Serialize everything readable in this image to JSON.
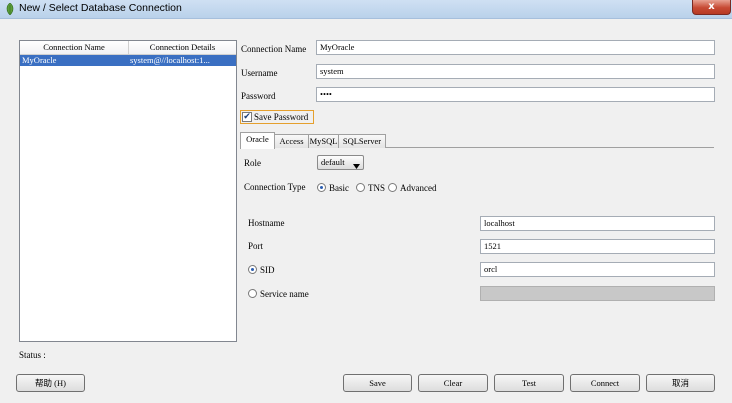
{
  "window": {
    "title": "New / Select Database Connection",
    "close_symbol": "x"
  },
  "connections_table": {
    "headers": [
      "Connection Name",
      "Connection Details"
    ],
    "rows": [
      {
        "name": "MyOracle",
        "details": "system@//localhost:1..."
      }
    ]
  },
  "form": {
    "connection_name_label": "Connection Name",
    "connection_name_value": "MyOracle",
    "username_label": "Username",
    "username_value": "system",
    "password_label": "Password",
    "password_value": "••••",
    "save_password_label": "Save Password",
    "save_password_checked": true
  },
  "tabs": [
    "Oracle",
    "Access",
    "MySQL",
    "SQLServer"
  ],
  "oracle": {
    "role_label": "Role",
    "role_value": "default",
    "connection_type_label": "Connection Type",
    "connection_types": [
      "Basic",
      "TNS",
      "Advanced"
    ],
    "selected_connection_type": "Basic",
    "hostname_label": "Hostname",
    "hostname_value": "localhost",
    "port_label": "Port",
    "port_value": "1521",
    "sid_label": "SID",
    "sid_value": "orcl",
    "service_name_label": "Service name",
    "service_name_value": ""
  },
  "status_label": "Status :",
  "buttons": {
    "help": "帮助 (H)",
    "save": "Save",
    "clear": "Clear",
    "test": "Test",
    "connect": "Connect",
    "cancel": "取消"
  },
  "colors": {
    "selection": "#3a6fc2",
    "title_bar": "#b9d1ea",
    "close_button": "#c74a34",
    "save_password_focus": "#e5a02e"
  },
  "icons": {
    "app": "database-leaf-icon",
    "close": "close-icon",
    "dropdown": "chevron-down-icon",
    "check": "checkmark-icon"
  }
}
